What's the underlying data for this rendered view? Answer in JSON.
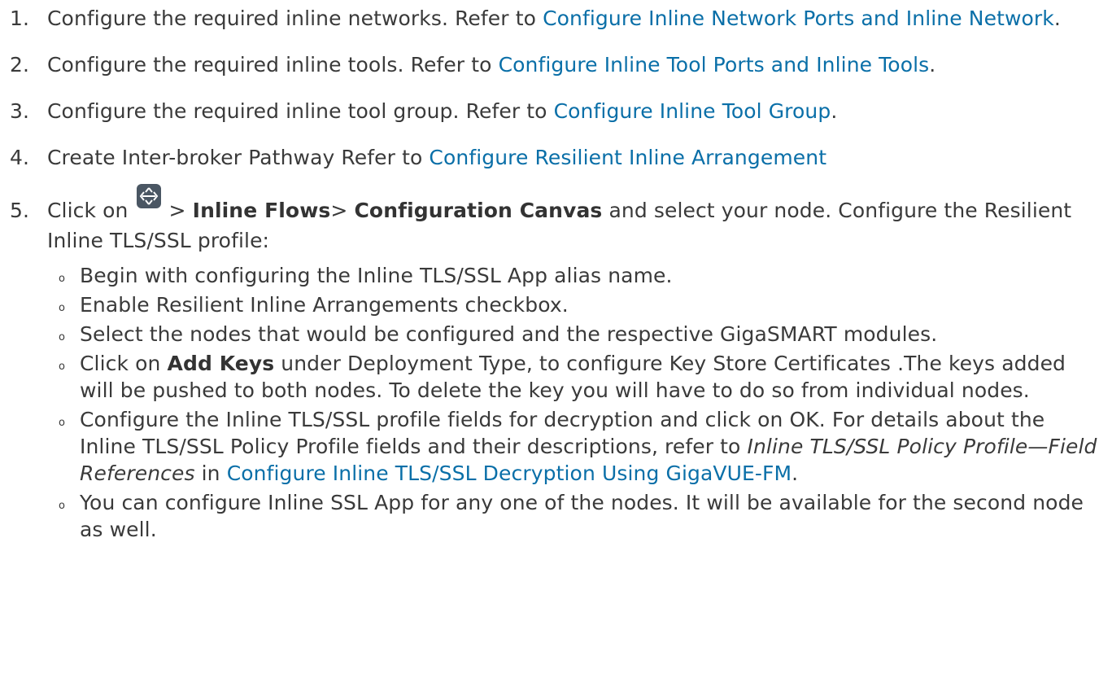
{
  "steps": [
    {
      "num": "1.",
      "pre": "Configure the required inline networks. Refer to ",
      "link": "Configure Inline Network Ports and Inline Network",
      "post": "."
    },
    {
      "num": "2.",
      "pre": "Configure the required inline tools. Refer to ",
      "link": "Configure Inline Tool Ports and Inline Tools",
      "post": "."
    },
    {
      "num": "3.",
      "pre": "Configure the required inline tool group. Refer to ",
      "link": "Configure Inline Tool Group",
      "post": "."
    },
    {
      "num": "4.",
      "pre": "Create Inter-broker Pathway Refer to ",
      "link": "Configure Resilient Inline Arrangement",
      "post": ""
    }
  ],
  "step5": {
    "num": "5.",
    "click_on": "Click on ",
    "icon": "traffic-flow-icon",
    "sep1": " > ",
    "bold1": "Inline Flows",
    "sep2": "> ",
    "bold2": "Configuration Canvas",
    "rest": " and select your node. Configure the Resilient Inline TLS/SSL profile:",
    "subs": {
      "s1": "Begin with configuring the Inline TLS/SSL App alias name.",
      "s2": "Enable Resilient Inline Arrangements checkbox.",
      "s3": "Select the nodes that would be configured and the respective GigaSMART modules.",
      "s4_pre": "Click on ",
      "s4_bold": "Add Keys",
      "s4_post": " under Deployment Type, to configure Key Store Certificates .The keys added will be pushed to both nodes. To delete the key you will have to do so from individual nodes.",
      "s5_pre": "Configure the Inline TLS/SSL profile fields for decryption and click on OK. For details about the Inline TLS/SSL Policy Profile fields and their descriptions, refer to ",
      "s5_italic": "Inline TLS/SSL Policy Profile—Field References",
      "s5_mid": " in ",
      "s5_link": "Configure Inline TLS/SSL Decryption Using GigaVUE-FM",
      "s5_post": ".",
      "s6": "You can configure Inline SSL App for any one of the nodes. It will be available for the second node as well."
    },
    "bullet_glyph": "o"
  }
}
